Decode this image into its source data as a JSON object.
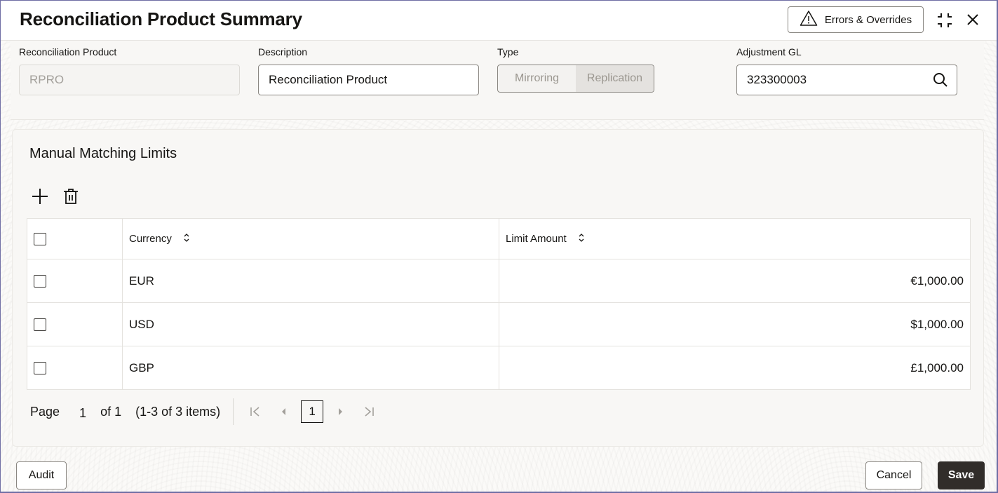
{
  "header": {
    "title": "Reconciliation Product Summary",
    "errors_button": "Errors & Overrides",
    "icons": {
      "warning": "warning-triangle-icon",
      "minimize": "compress-icon",
      "close": "close-icon"
    }
  },
  "form": {
    "reconciliation_product": {
      "label": "Reconciliation Product",
      "value": "RPRO",
      "readonly": true
    },
    "description": {
      "label": "Description",
      "value": "Reconciliation Product"
    },
    "type": {
      "label": "Type",
      "options": [
        "Mirroring",
        "Replication"
      ],
      "selected": "Replication"
    },
    "adjustment_gl": {
      "label": "Adjustment GL",
      "value": "323300003"
    }
  },
  "limits": {
    "title": "Manual Matching Limits",
    "columns": [
      "Currency",
      "Limit Amount"
    ],
    "rows": [
      {
        "currency": "EUR",
        "amount": "€1,000.00"
      },
      {
        "currency": "USD",
        "amount": "$1,000.00"
      },
      {
        "currency": "GBP",
        "amount": "£1,000.00"
      }
    ],
    "pagination": {
      "page_label": "Page",
      "page": "1",
      "of_label": "of 1",
      "items_label": "(1-3 of 3 items)",
      "current_page": "1"
    }
  },
  "footer": {
    "audit": "Audit",
    "cancel": "Cancel",
    "save": "Save"
  }
}
